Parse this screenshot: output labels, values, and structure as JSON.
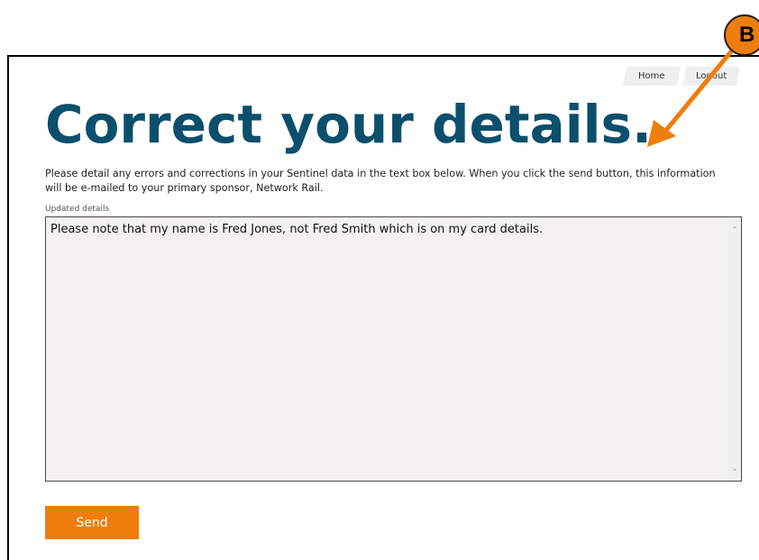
{
  "nav": {
    "home": "Home",
    "logout": "Logout"
  },
  "page": {
    "title": "Correct your details.",
    "intro": "Please detail any errors and corrections in your Sentinel data in the text box below. When you click the send button, this information will be e-mailed to your primary sponsor, Network Rail.",
    "field_label": "Updated details",
    "field_value": "Please note that my name is Fred Jones, not Fred Smith which is on my card details."
  },
  "actions": {
    "send_label": "Send"
  },
  "annotation": {
    "badge_letter": "B",
    "color": "#ef7d0e"
  },
  "colors": {
    "title": "#0b4f6c",
    "accent": "#ef7d0e",
    "field_bg": "#f3f1f2"
  }
}
